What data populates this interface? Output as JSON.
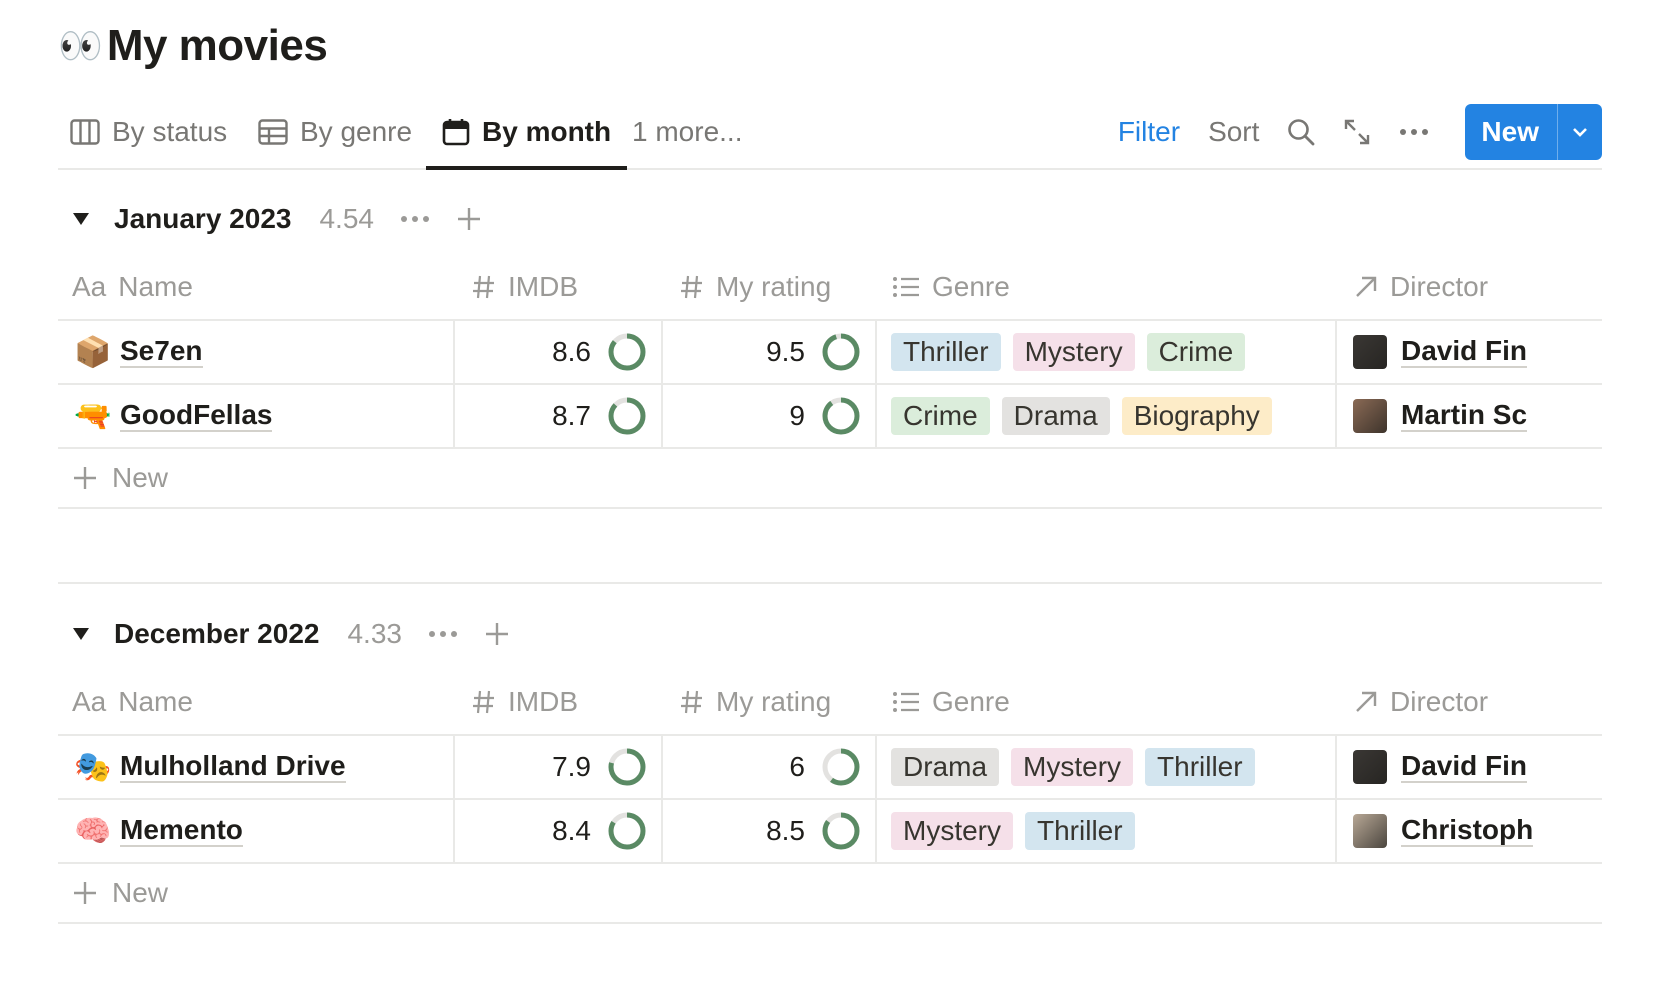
{
  "page": {
    "emoji": "👀",
    "title": "My movies"
  },
  "views": {
    "tabs": [
      {
        "icon": "board-icon",
        "label": "By status"
      },
      {
        "icon": "table-icon",
        "label": "By genre"
      },
      {
        "icon": "calendar-icon",
        "label": "By month",
        "active": true
      }
    ],
    "more": "1 more...",
    "filter": "Filter",
    "sort": "Sort",
    "new_label": "New"
  },
  "columns": {
    "name": "Name",
    "imdb": "IMDB",
    "my_rating": "My rating",
    "genre": "Genre",
    "director": "Director",
    "name_prefix": "Aa"
  },
  "tag_colors": {
    "Thriller": "#d3e5ef",
    "Mystery": "#f5e0e9",
    "Crime": "#dbeddb",
    "Drama": "#e3e2e0",
    "Biography": "#fdecc8"
  },
  "ring_color": "#5a8a64",
  "groups": [
    {
      "title": "January 2023",
      "avg": "4.54",
      "rows": [
        {
          "icon": "📦",
          "name": "Se7en",
          "imdb": "8.6",
          "imdb_fill": 0.86,
          "rating": "9.5",
          "rating_fill": 0.95,
          "genres": [
            "Thriller",
            "Mystery",
            "Crime"
          ],
          "director": "David Fin",
          "avatar_color": "#3a3734"
        },
        {
          "icon": "🔫",
          "name": "GoodFellas",
          "imdb": "8.7",
          "imdb_fill": 0.87,
          "rating": "9",
          "rating_fill": 0.9,
          "genres": [
            "Crime",
            "Drama",
            "Biography"
          ],
          "director": "Martin Sc",
          "avatar_color": "#8a6a55"
        }
      ],
      "new_label": "New"
    },
    {
      "title": "December 2022",
      "avg": "4.33",
      "rows": [
        {
          "icon": "🎭",
          "name": "Mulholland Drive",
          "imdb": "7.9",
          "imdb_fill": 0.79,
          "rating": "6",
          "rating_fill": 0.6,
          "genres": [
            "Drama",
            "Mystery",
            "Thriller"
          ],
          "director": "David Fin",
          "avatar_color": "#3a3734"
        },
        {
          "icon": "🧠",
          "name": "Memento",
          "imdb": "8.4",
          "imdb_fill": 0.84,
          "rating": "8.5",
          "rating_fill": 0.85,
          "genres": [
            "Mystery",
            "Thriller"
          ],
          "director": "Christoph",
          "avatar_color": "#b8a896"
        }
      ],
      "new_label": "New"
    }
  ]
}
